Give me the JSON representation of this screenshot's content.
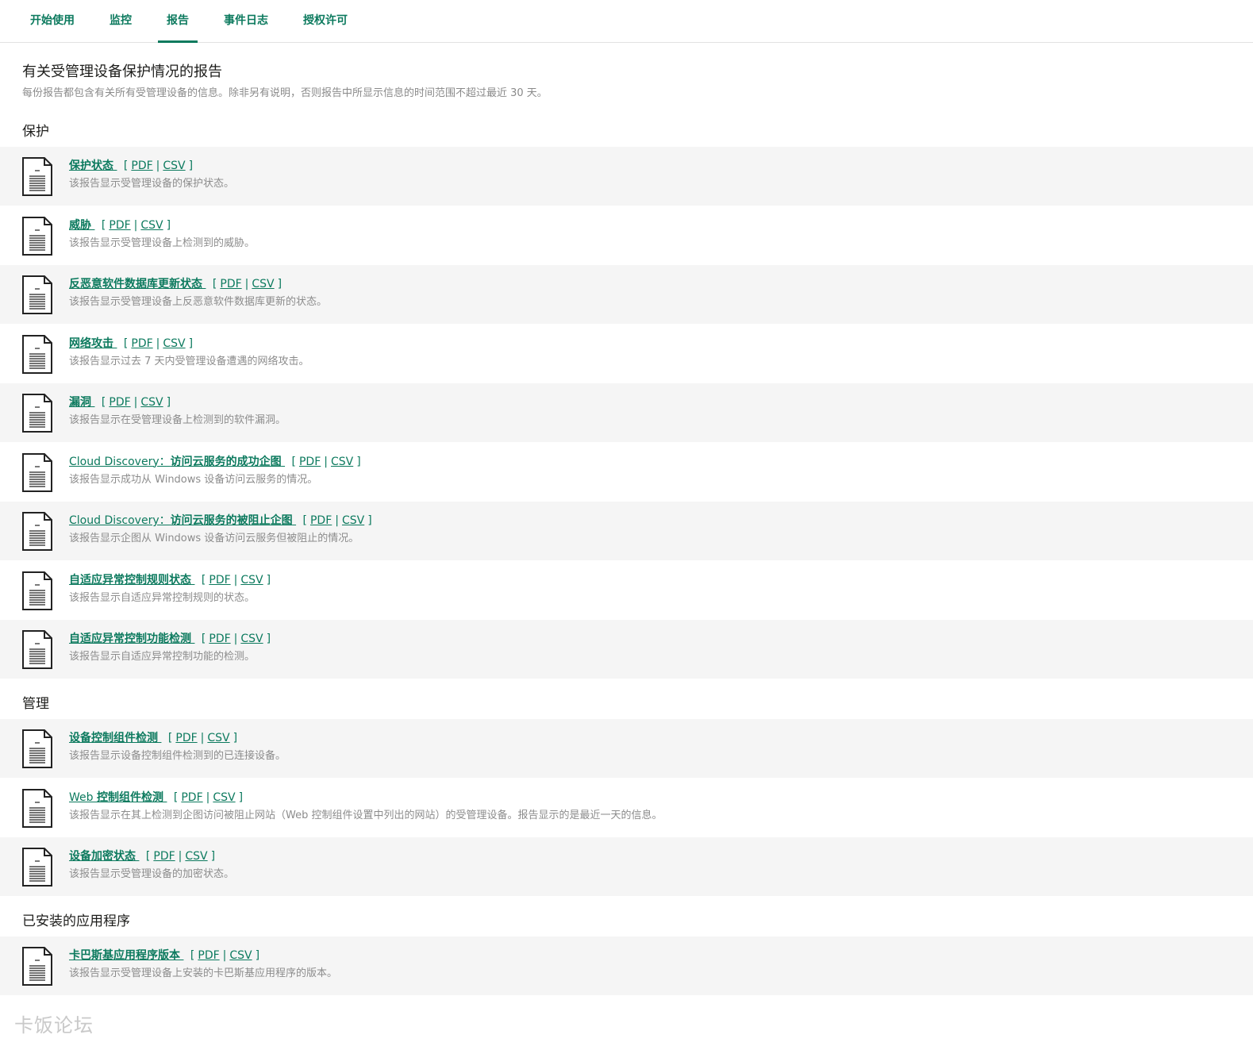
{
  "nav": {
    "tabs": [
      {
        "label": "开始使用"
      },
      {
        "label": "监控"
      },
      {
        "label": "报告"
      },
      {
        "label": "事件日志"
      },
      {
        "label": "授权许可"
      }
    ]
  },
  "header": {
    "title": "有关受管理设备保护情况的报告",
    "description": "每份报告都包含有关所有受管理设备的信息。除非另有说明，否则报告中所显示信息的时间范围不超过最近 30 天。"
  },
  "link_labels": {
    "pdf": "PDF",
    "csv": "CSV",
    "open": "[",
    "close": "]",
    "sep": "|"
  },
  "sections": [
    {
      "heading": "保护",
      "reports": [
        {
          "title": "保护状态",
          "description": "该报告显示受管理设备的保护状态。"
        },
        {
          "title": "威胁",
          "description": "该报告显示受管理设备上检测到的威胁。"
        },
        {
          "title": "反恶意软件数据库更新状态",
          "description": "该报告显示受管理设备上反恶意软件数据库更新的状态。"
        },
        {
          "title": "网络攻击",
          "description": "该报告显示过去 7 天内受管理设备遭遇的网络攻击。"
        },
        {
          "title": "漏洞",
          "description": "该报告显示在受管理设备上检测到的软件漏洞。"
        },
        {
          "title_prefix": "Cloud Discovery：",
          "title": "访问云服务的成功企图",
          "description": "该报告显示成功从 Windows 设备访问云服务的情况。"
        },
        {
          "title_prefix": "Cloud Discovery：",
          "title": "访问云服务的被阻止企图",
          "description": "该报告显示企图从 Windows 设备访问云服务但被阻止的情况。"
        },
        {
          "title": "自适应异常控制规则状态",
          "description": "该报告显示自适应异常控制规则的状态。"
        },
        {
          "title": "自适应异常控制功能检测",
          "description": "该报告显示自适应异常控制功能的检测。"
        }
      ]
    },
    {
      "heading": "管理",
      "reports": [
        {
          "title": "设备控制组件检测",
          "description": "该报告显示设备控制组件检测到的已连接设备。"
        },
        {
          "title_prefix": "Web ",
          "title": "控制组件检测",
          "description": "该报告显示在其上检测到企图访问被阻止网站（Web 控制组件设置中列出的网站）的受管理设备。报告显示的是最近一天的信息。"
        },
        {
          "title": "设备加密状态",
          "description": "该报告显示受管理设备的加密状态。"
        }
      ]
    },
    {
      "heading": "已安装的应用程序",
      "reports": [
        {
          "title": "卡巴斯基应用程序版本",
          "description": "该报告显示受管理设备上安装的卡巴斯基应用程序的版本。"
        }
      ]
    }
  ],
  "watermark": "卡饭论坛",
  "colors": {
    "accent": "#0c7a5e",
    "row_shade": "#f5f5f5",
    "muted_text": "#8c8c8c"
  },
  "icons": {
    "report": "document-icon"
  }
}
